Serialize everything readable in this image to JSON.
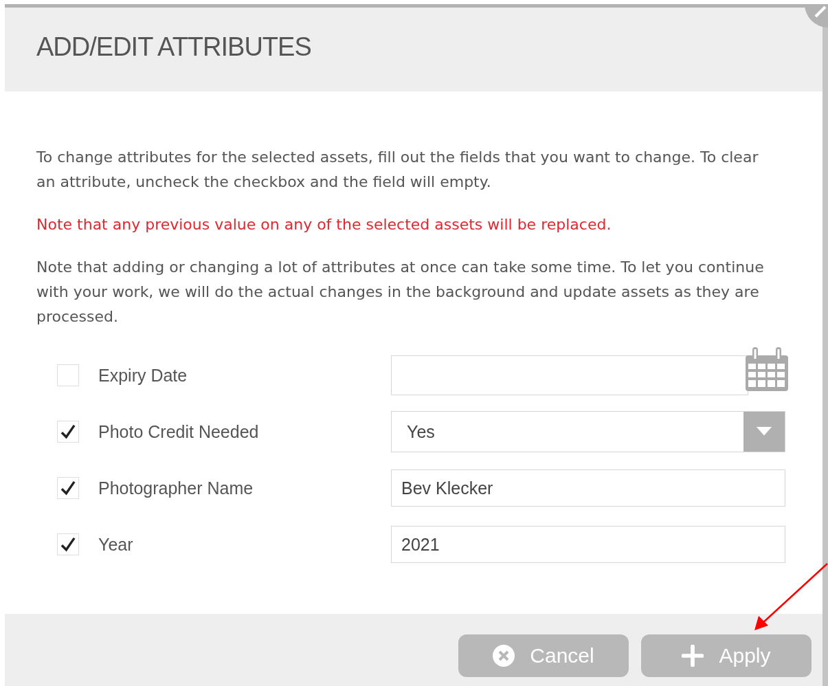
{
  "dialog": {
    "title": "ADD/EDIT ATTRIBUTES",
    "intro": "To change attributes for the selected assets, fill out the fields that you want to change. To clear an attribute, uncheck the checkbox and the field will empty.",
    "warning": "Note that any previous value on any of the selected assets will be replaced.",
    "note": "Note that adding or changing a lot of attributes at once can take some time. To let you continue with your work, we will do the actual changes in the background and update assets as they are processed.",
    "attributes": [
      {
        "label": "Expiry Date",
        "checked": false,
        "kind": "date"
      },
      {
        "label": "Photo Credit Needed",
        "checked": true,
        "kind": "select",
        "value": "Yes"
      },
      {
        "label": "Photographer Name",
        "checked": true,
        "kind": "text",
        "value": "Bev Klecker"
      },
      {
        "label": "Year",
        "checked": true,
        "kind": "text",
        "value": "2021"
      }
    ],
    "buttons": [
      {
        "label": "Cancel",
        "kind": "cancel"
      },
      {
        "label": "Apply",
        "kind": "apply"
      }
    ]
  }
}
